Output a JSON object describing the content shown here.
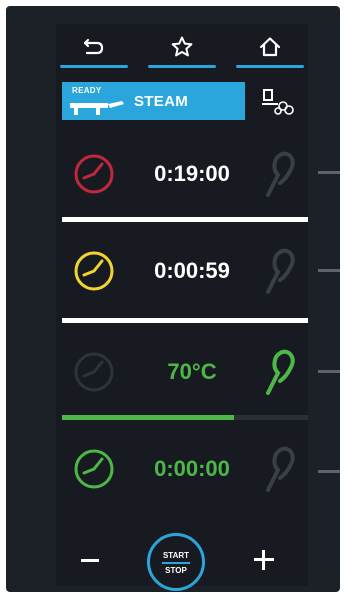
{
  "nav": {
    "items": [
      {
        "name": "back",
        "icon": "back-arrow-icon"
      },
      {
        "name": "favorites",
        "icon": "star-icon"
      },
      {
        "name": "home",
        "icon": "home-icon"
      }
    ],
    "accent": "#2ba6dd"
  },
  "mode": {
    "badge": "READY",
    "label": "STEAM",
    "icon": "cart-icon",
    "function_icon": "oven-function-icon"
  },
  "rows": [
    {
      "id": "timer-1",
      "value": "0:19:00",
      "value_color": "#ffffff",
      "clock_color": "#c0283c",
      "probe_color": "#3a3f46",
      "progress": 1.0,
      "bar_color": "#ffffff"
    },
    {
      "id": "timer-2",
      "value": "0:00:59",
      "value_color": "#ffffff",
      "clock_color": "#f1d431",
      "probe_color": "#3a3f46",
      "progress": 1.0,
      "bar_color": "#ffffff"
    },
    {
      "id": "probe-temp",
      "value": "70°C",
      "value_color": "#4db848",
      "clock_color": "#2e333a",
      "probe_color": "#4db848",
      "progress": 0.7,
      "bar_color": "#4db848"
    },
    {
      "id": "timer-3",
      "value": "0:00:00",
      "value_color": "#4db848",
      "clock_color": "#4db848",
      "probe_color": "#3a3f46",
      "progress": 0,
      "bar_color": "#4db848"
    }
  ],
  "controls": {
    "start_label": "START",
    "stop_label": "STOP"
  }
}
